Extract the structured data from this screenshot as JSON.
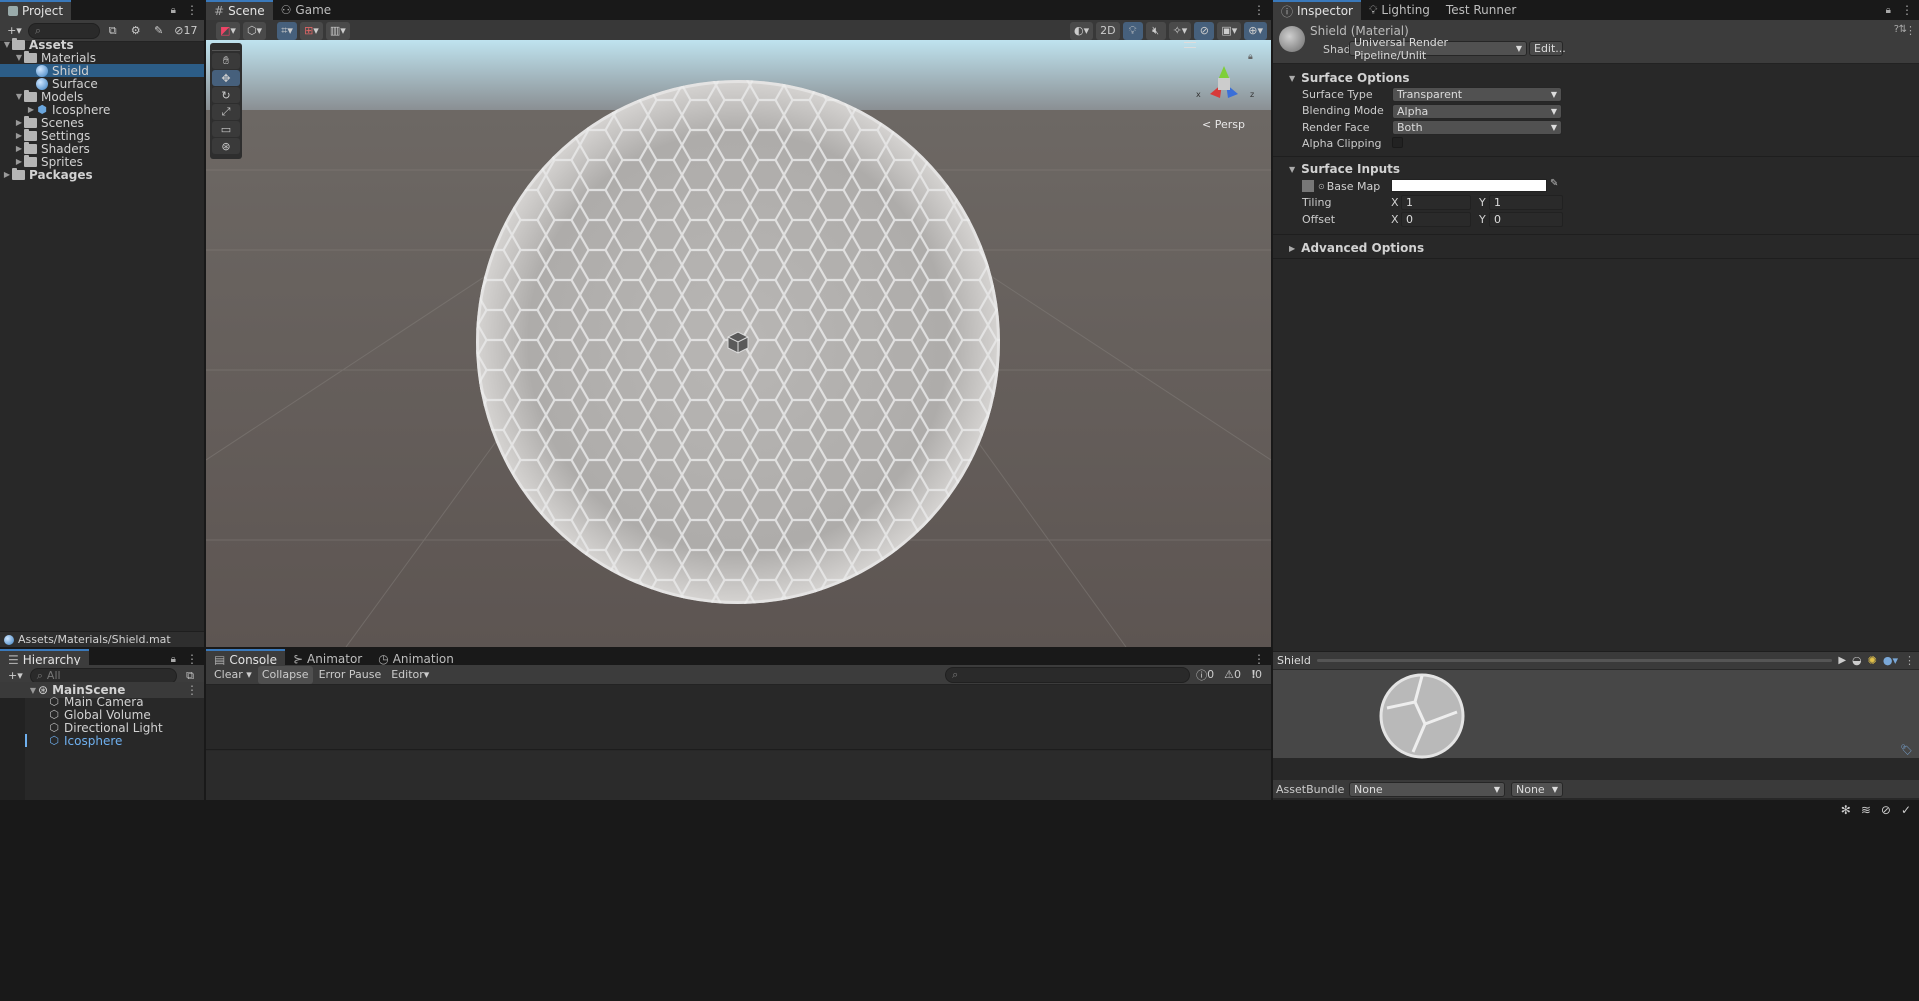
{
  "project": {
    "tab": "Project",
    "hidden_count": "17",
    "tree": [
      {
        "label": "Assets",
        "indent": 0,
        "bold": true,
        "type": "folder",
        "open": true
      },
      {
        "label": "Materials",
        "indent": 1,
        "type": "folder",
        "open": true
      },
      {
        "label": "Shield",
        "indent": 2,
        "type": "material",
        "selected": true
      },
      {
        "label": "Surface",
        "indent": 2,
        "type": "material"
      },
      {
        "label": "Models",
        "indent": 1,
        "type": "folder",
        "open": true
      },
      {
        "label": "Icosphere",
        "indent": 2,
        "type": "model",
        "collapsed": true
      },
      {
        "label": "Scenes",
        "indent": 1,
        "type": "folder",
        "collapsed": true
      },
      {
        "label": "Settings",
        "indent": 1,
        "type": "folder",
        "collapsed": true
      },
      {
        "label": "Shaders",
        "indent": 1,
        "type": "folder",
        "collapsed": true
      },
      {
        "label": "Sprites",
        "indent": 1,
        "type": "folder",
        "collapsed": true
      },
      {
        "label": "Packages",
        "indent": 0,
        "bold": true,
        "type": "folder",
        "collapsed": true
      }
    ],
    "path": "Assets/Materials/Shield.mat"
  },
  "hierarchy": {
    "tab": "Hierarchy",
    "search_placeholder": "All",
    "scene": "MainScene",
    "items": [
      {
        "label": "Main Camera"
      },
      {
        "label": "Global Volume"
      },
      {
        "label": "Directional Light"
      },
      {
        "label": "Icosphere",
        "highlight": true
      }
    ]
  },
  "scene": {
    "tabs": [
      "Scene",
      "Game"
    ],
    "toolbar_2d": "2D",
    "persp_label": "< Persp",
    "gizmo_axes": {
      "x": "x",
      "z": "z"
    }
  },
  "console": {
    "tabs": [
      "Console",
      "Animator",
      "Animation"
    ],
    "clear": "Clear",
    "collapse": "Collapse",
    "error_pause": "Error Pause",
    "editor": "Editor",
    "counts": {
      "log": "0",
      "warn": "0",
      "error": "0"
    }
  },
  "inspector": {
    "tabs": [
      "Inspector",
      "Lighting",
      "Test Runner"
    ],
    "title": "Shield (Material)",
    "shader_label": "Shader",
    "shader_value": "Universal Render Pipeline/Unlit",
    "edit_button": "Edit...",
    "surface_options": {
      "header": "Surface Options",
      "rows": [
        {
          "label": "Surface Type",
          "value": "Transparent"
        },
        {
          "label": "Blending Mode",
          "value": "Alpha"
        },
        {
          "label": "Render Face",
          "value": "Both"
        }
      ],
      "alpha_clipping": "Alpha Clipping"
    },
    "surface_inputs": {
      "header": "Surface Inputs",
      "base_map": "Base Map",
      "tiling": {
        "label": "Tiling",
        "x": "1",
        "y": "1"
      },
      "offset": {
        "label": "Offset",
        "x": "0",
        "y": "0"
      },
      "x_label": "X",
      "y_label": "Y"
    },
    "advanced": "Advanced Options",
    "preview_title": "Shield",
    "asset_bundle_label": "AssetBundle",
    "asset_bundle_value": "None",
    "asset_bundle_variant": "None"
  },
  "colors": {
    "accent": "#2c5d87",
    "selection_text": "#6fb0ef"
  }
}
